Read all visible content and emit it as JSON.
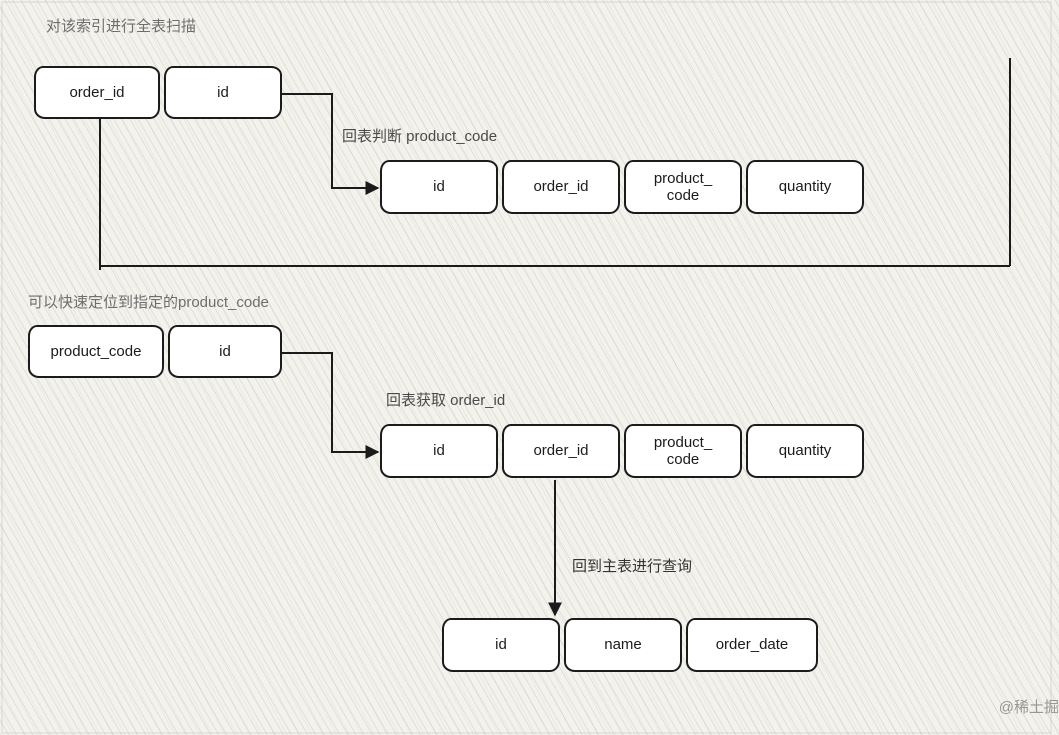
{
  "section1": {
    "title": "对该索引进行全表扫描",
    "index_cells": [
      "order_id",
      "id"
    ],
    "lookup_label": "回表判断 product_code",
    "table_cells": [
      "id",
      "order_id",
      "product_\ncode",
      "quantity"
    ]
  },
  "section2": {
    "title": "可以快速定位到指定的product_code",
    "index_cells": [
      "product_code",
      "id"
    ],
    "lookup_label": "回表获取 order_id",
    "table_cells": [
      "id",
      "order_id",
      "product_\ncode",
      "quantity"
    ],
    "final_label": "回到主表进行查询",
    "main_table_cells": [
      "id",
      "name",
      "order_date"
    ]
  },
  "watermark": "@稀土掘"
}
